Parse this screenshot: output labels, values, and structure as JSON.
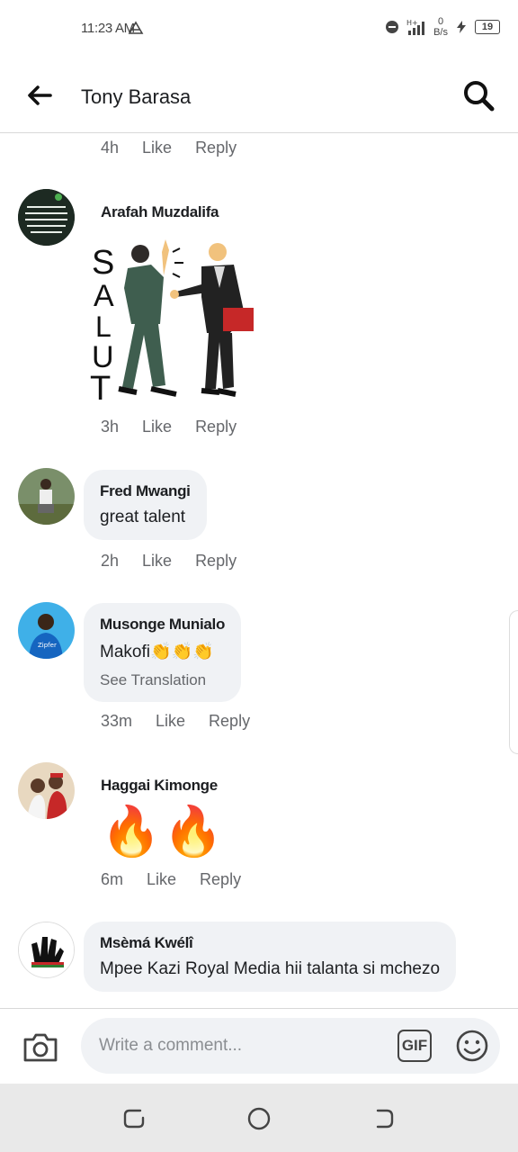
{
  "status": {
    "time": "11:23 AM",
    "net_speed_value": "0",
    "net_speed_unit": "B/s",
    "battery": "19"
  },
  "header": {
    "title": "Tony Barasa",
    "back_icon": "arrow-left-icon",
    "search_icon": "search-icon"
  },
  "top_meta": {
    "time": "4h",
    "like": "Like",
    "reply": "Reply"
  },
  "comments": [
    {
      "author": "Arafah Muzdalifa",
      "time": "3h",
      "like": "Like",
      "reply": "Reply",
      "sticker_text": "SALUT"
    },
    {
      "author": "Fred Mwangi",
      "text": "great talent",
      "time": "2h",
      "like": "Like",
      "reply": "Reply"
    },
    {
      "author": "Musonge Munialo",
      "text": "Makofi👏👏👏",
      "see_translation": "See Translation",
      "time": "33m",
      "like": "Like",
      "reply": "Reply"
    },
    {
      "author": "Haggai Kimonge",
      "emojis": "🔥🔥",
      "time": "6m",
      "like": "Like",
      "reply": "Reply"
    },
    {
      "author": "Msèmá Kwélî",
      "text": "Mpee Kazi Royal Media hii talanta si mchezo"
    }
  ],
  "composer": {
    "placeholder": "Write a comment...",
    "gif_label": "GIF"
  },
  "colors": {
    "bubble": "#f0f2f5",
    "meta": "#65676b",
    "text": "#1c1e21"
  }
}
